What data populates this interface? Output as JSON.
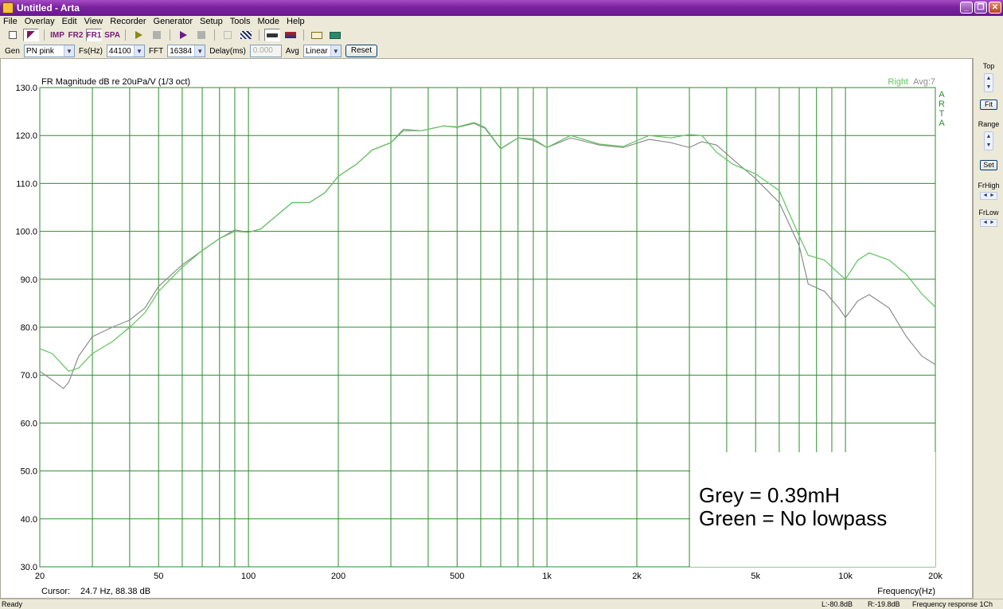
{
  "window": {
    "title": "Untitled - Arta"
  },
  "menu": [
    "File",
    "Overlay",
    "Edit",
    "View",
    "Recorder",
    "Generator",
    "Setup",
    "Tools",
    "Mode",
    "Help"
  ],
  "toolbar": {
    "buttons": [
      {
        "name": "new-icon",
        "label": ""
      },
      {
        "name": "overlay-icon",
        "label": ""
      },
      {
        "name": "imp-mode-button",
        "label": "IMP"
      },
      {
        "name": "fr2-mode-button",
        "label": "FR2"
      },
      {
        "name": "fr1-mode-button",
        "label": "FR1"
      },
      {
        "name": "spa-mode-button",
        "label": "SPA"
      }
    ]
  },
  "genbar": {
    "gen_label": "Gen",
    "gen_value": "PN pink",
    "fs_label": "Fs(Hz)",
    "fs_value": "44100",
    "fft_label": "FFT",
    "fft_value": "16384",
    "delay_label": "Delay(ms)",
    "delay_value": "0.000",
    "avg_label": "Avg",
    "avg_value": "Linear",
    "reset_label": "Reset"
  },
  "plot": {
    "header": "FR Magnitude dB re 20uPa/V (1/3 oct)",
    "channel_label": "Right",
    "avg_label": "Avg:7",
    "side_logo": [
      "A",
      "R",
      "T",
      "A"
    ],
    "cursor_label": "Cursor:",
    "cursor_value": "24.7 Hz, 88.38 dB",
    "xaxis_label": "Frequency(Hz)",
    "annotation_line1": "Grey = 0.39mH",
    "annotation_line2": "Green = No lowpass",
    "grid_color": "#2e8b2e",
    "text_color": "#000000"
  },
  "rightpanel": {
    "top_label": "Top",
    "fit_label": "Fit",
    "range_label": "Range",
    "set_label": "Set",
    "frhigh_label": "FrHigh",
    "frlow_label": "FrLow"
  },
  "status": {
    "left": "Ready",
    "l_level": "L:-80.8dB",
    "r_level": "R:-19.8dB",
    "mode": "Frequency response 1Ch"
  },
  "chart_data": {
    "type": "line",
    "title": "FR Magnitude dB re 20uPa/V (1/3 oct)",
    "xlabel": "Frequency(Hz)",
    "ylabel": "",
    "xscale": "log",
    "xlim": [
      20,
      20000
    ],
    "ylim": [
      30,
      130
    ],
    "xticks": [
      "20",
      "50",
      "100",
      "200",
      "500",
      "1k",
      "2k",
      "5k",
      "10k",
      "20k"
    ],
    "xtick_values": [
      20,
      50,
      100,
      200,
      500,
      1000,
      2000,
      5000,
      10000,
      20000
    ],
    "yticks": [
      "130.0",
      "120.0",
      "110.0",
      "100.0",
      "90.0",
      "80.0",
      "70.0",
      "60.0",
      "50.0",
      "40.0",
      "30.0"
    ],
    "ytick_values": [
      130,
      120,
      110,
      100,
      90,
      80,
      70,
      60,
      50,
      40,
      30
    ],
    "grid": true,
    "series": [
      {
        "name": "Grey = 0.39mH",
        "color": "#8c8c8c",
        "x": [
          20,
          22,
          24,
          25,
          27,
          30,
          35,
          40,
          45,
          50,
          60,
          70,
          80,
          90,
          100,
          110,
          120,
          140,
          160,
          180,
          200,
          230,
          260,
          300,
          330,
          380,
          450,
          500,
          570,
          620,
          700,
          800,
          900,
          1000,
          1200,
          1500,
          1800,
          2200,
          2600,
          3000,
          3300,
          3700,
          4200,
          5000,
          6000,
          7000,
          7500,
          8500,
          9500,
          10000,
          11000,
          12000,
          14000,
          16000,
          18000,
          20000
        ],
        "y": [
          70.8,
          69,
          67.2,
          68.5,
          74,
          78,
          80,
          81.5,
          84,
          88.5,
          93,
          96,
          98.5,
          100.3,
          99.8,
          100.5,
          102.5,
          106,
          106,
          108,
          111.5,
          114,
          117,
          118.5,
          121,
          121,
          122,
          121.7,
          122.5,
          121.5,
          117.2,
          119.5,
          119,
          117.5,
          119.5,
          118,
          117.5,
          119.2,
          118.5,
          117.5,
          118.7,
          118,
          115,
          111,
          106,
          97,
          89,
          87.5,
          84,
          82,
          85.5,
          86.8,
          84,
          78,
          74,
          72.2
        ]
      },
      {
        "name": "Green = No lowpass",
        "color": "#5fc45f",
        "x": [
          20,
          22,
          24,
          25,
          27,
          30,
          35,
          40,
          45,
          50,
          60,
          70,
          80,
          90,
          100,
          110,
          120,
          140,
          160,
          180,
          200,
          230,
          260,
          300,
          330,
          380,
          450,
          500,
          570,
          620,
          700,
          800,
          900,
          1000,
          1200,
          1500,
          1800,
          2200,
          2600,
          3000,
          3300,
          3700,
          4200,
          5000,
          6000,
          7000,
          7500,
          8500,
          9500,
          10000,
          11000,
          12000,
          14000,
          16000,
          18000,
          20000
        ],
        "y": [
          75.5,
          74.5,
          72,
          70.8,
          71.5,
          74.5,
          77,
          80,
          83,
          87.5,
          92.5,
          96,
          98.5,
          100,
          99.8,
          100.5,
          102.5,
          106,
          106,
          108,
          111.5,
          114,
          117,
          118.5,
          121.3,
          121,
          122,
          121.8,
          122.7,
          121.7,
          117.3,
          119.5,
          119.3,
          117.5,
          120,
          118.2,
          117.7,
          120,
          119.5,
          120.2,
          120,
          116.5,
          114,
          112,
          108.5,
          99,
          95,
          94,
          91.2,
          90,
          94,
          95.5,
          94,
          91,
          87,
          84.2
        ]
      }
    ]
  }
}
